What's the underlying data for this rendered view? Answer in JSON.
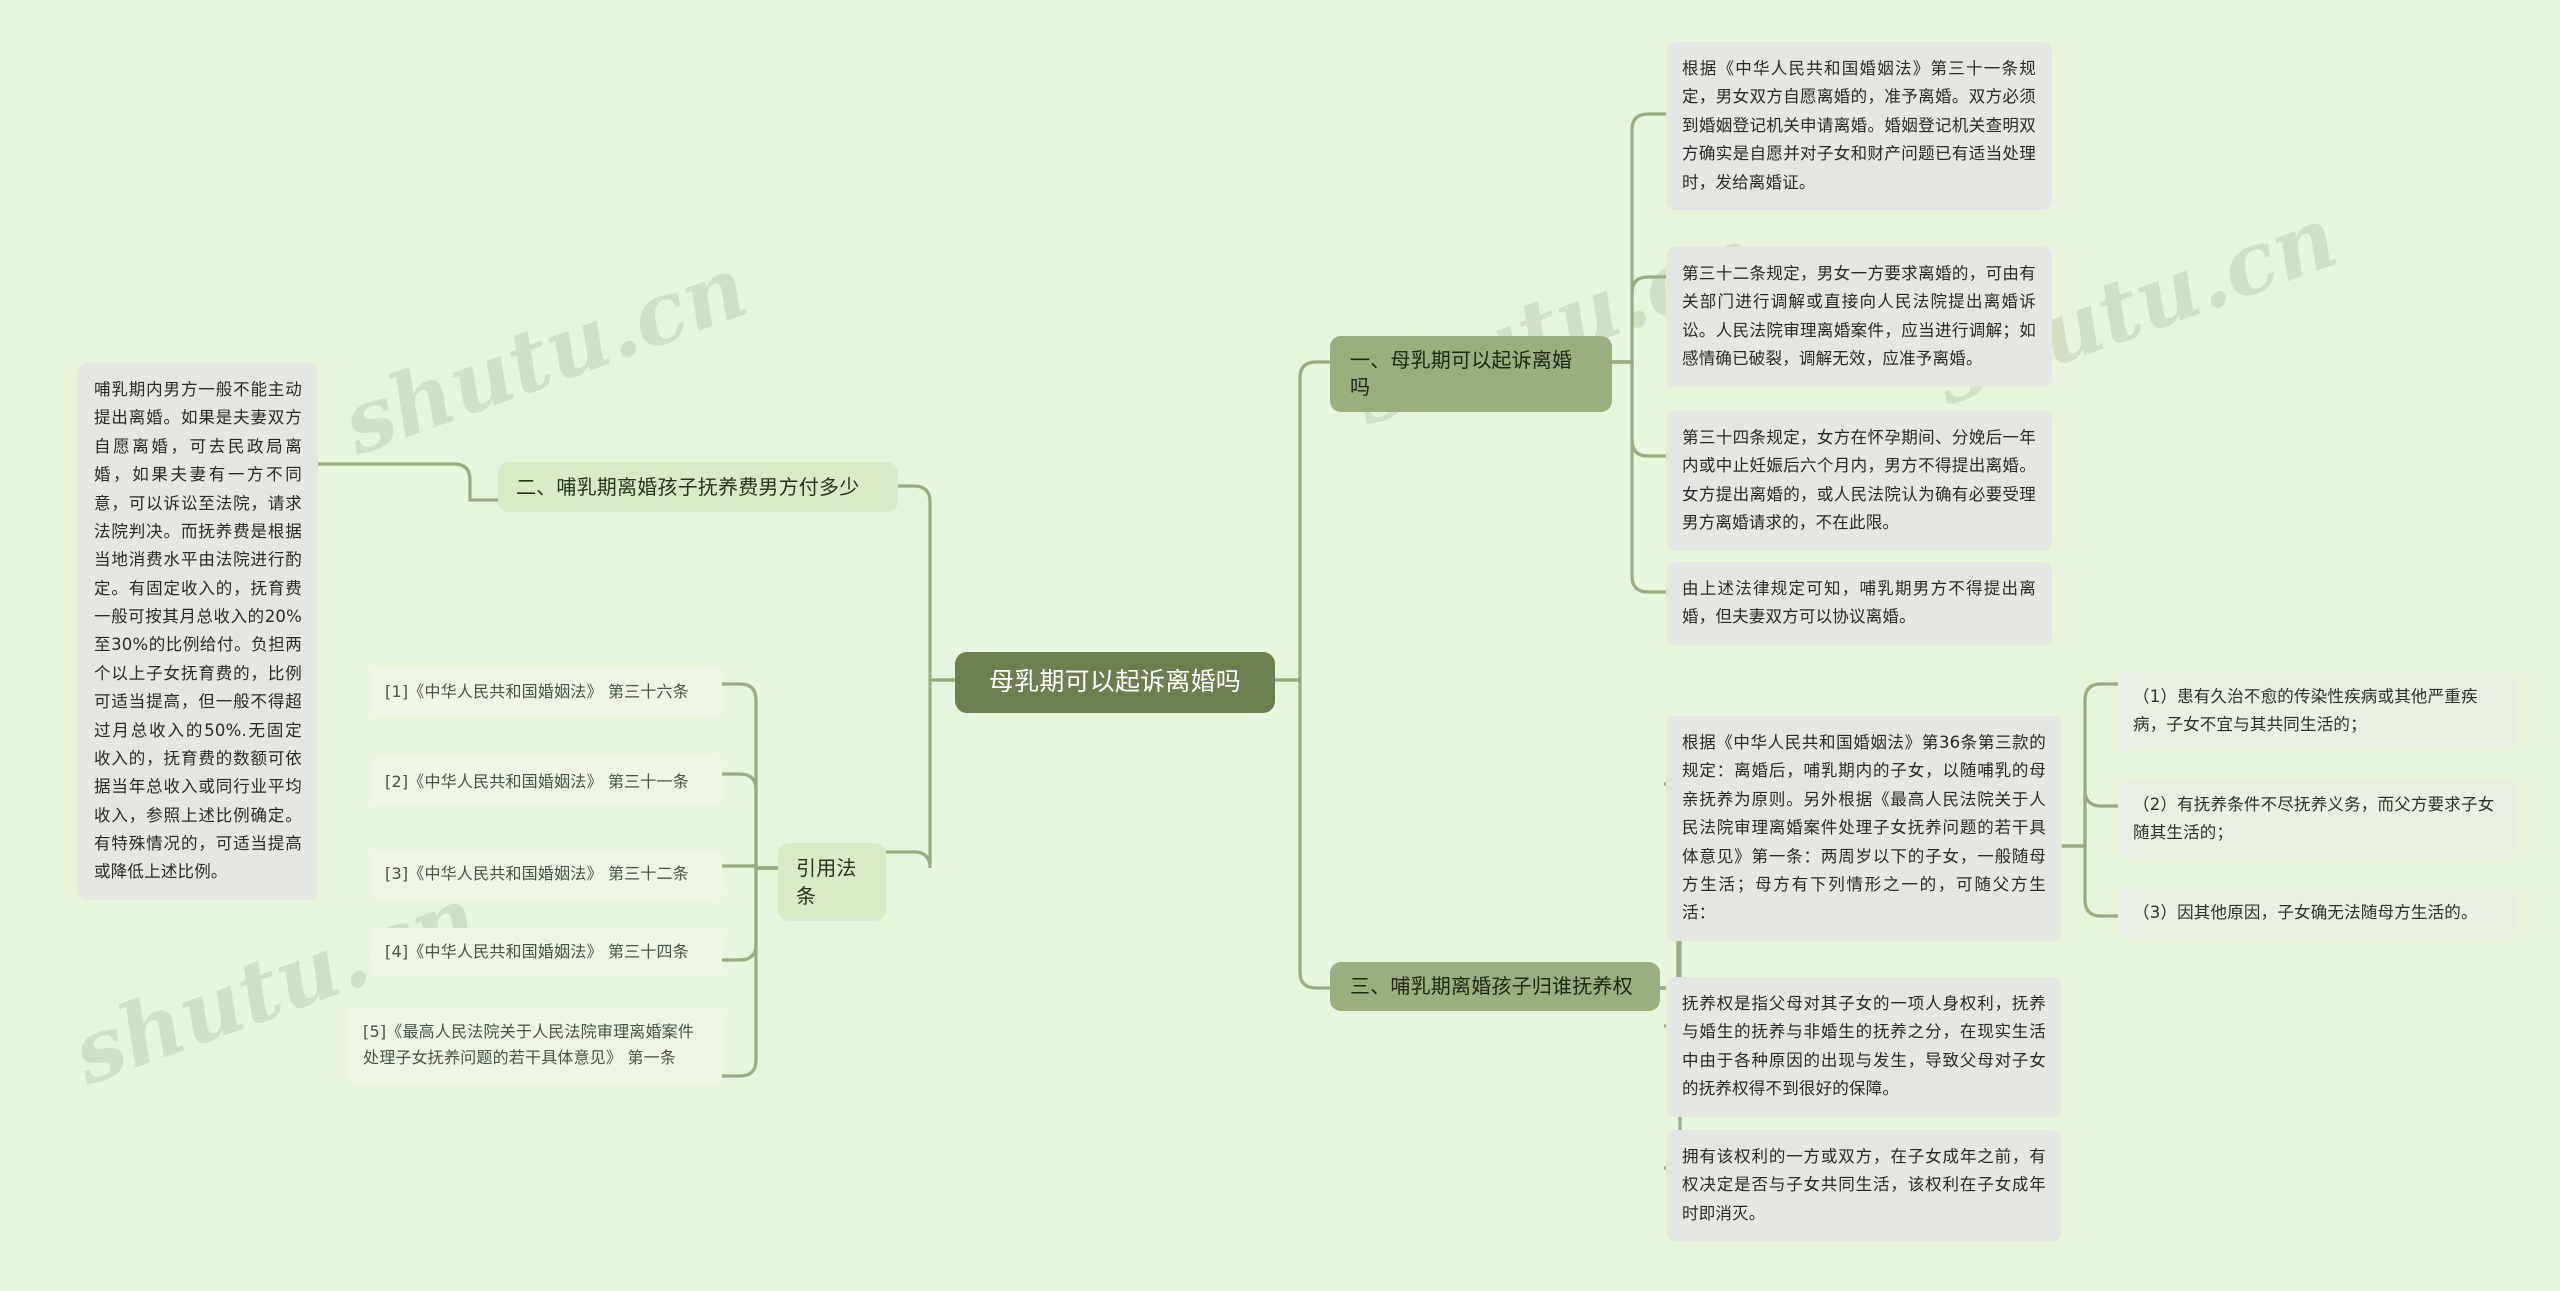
{
  "watermarks": {
    "a": "shutu.cn",
    "b": "shutu.cn",
    "c": "shutu.cn",
    "d": "shutu.cn"
  },
  "colors": {
    "canvas": "#e9f4dd",
    "root_fill": "#6d7f51",
    "root_text": "#ffffff",
    "branch_fill": "#9bae80",
    "chip_light_fill": "#d9ebc6",
    "card_fill": "#e4e7e1",
    "cite_fill": "#eef5e5",
    "subitem_fill": "#e9efe3",
    "wire": "#9aab82"
  },
  "root": {
    "label": "母乳期可以起诉离婚吗"
  },
  "branches": {
    "one": {
      "label": "一、母乳期可以起诉离婚吗",
      "cards": [
        "根据《中华人民共和国婚姻法》第三十一条规定，男女双方自愿离婚的，准予离婚。双方必须到婚姻登记机关申请离婚。婚姻登记机关查明双方确实是自愿并对子女和财产问题已有适当处理时，发给离婚证。",
        "第三十二条规定，男女一方要求离婚的，可由有关部门进行调解或直接向人民法院提出离婚诉讼。人民法院审理离婚案件，应当进行调解；如感情确已破裂，调解无效，应准予离婚。",
        "第三十四条规定，女方在怀孕期间、分娩后一年内或中止妊娠后六个月内，男方不得提出离婚。女方提出离婚的，或人民法院认为确有必要受理男方离婚请求的，不在此限。",
        "由上述法律规定可知，哺乳期男方不得提出离婚，但夫妻双方可以协议离婚。"
      ]
    },
    "two": {
      "label": "二、哺乳期离婚孩子抚养费男方付多少",
      "cards": [
        "哺乳期内男方一般不能主动提出离婚。如果是夫妻双方自愿离婚，可去民政局离婚，如果夫妻有一方不同意，可以诉讼至法院，请求法院判决。而抚养费是根据当地消费水平由法院进行酌定。有固定收入的，抚育费一般可按其月总收入的20%至30%的比例给付。负担两个以上子女抚育费的，比例可适当提高，但一般不得超过月总收入的50%.无固定收入的，抚育费的数额可依据当年总收入或同行业平均收入，参照上述比例确定。有特殊情况的，可适当提高或降低上述比例。"
      ]
    },
    "three": {
      "label": "三、哺乳期离婚孩子归谁抚养权",
      "cards": [
        "根据《中华人民共和国婚姻法》第36条第三款的规定：离婚后，哺乳期内的子女，以随哺乳的母亲抚养为原则。另外根据《最高人民法院关于人民法院审理离婚案件处理子女抚养问题的若干具体意见》第一条：两周岁以下的子女，一般随母方生活；母方有下列情形之一的，可随父方生活：",
        "抚养权是指父母对其子女的一项人身权利，抚养与婚生的抚养与非婚生的抚养之分，在现实生活中由于各种原因的出现与发生，导致父母对子女的抚养权得不到很好的保障。",
        "拥有该权利的一方或双方，在子女成年之前，有权决定是否与子女共同生活，该权利在子女成年时即消灭。"
      ],
      "subitems": [
        "（1）患有久治不愈的传染性疾病或其他严重疾病，子女不宜与其共同生活的；",
        "（2）有抚养条件不尽抚养义务，而父方要求子女随其生活的；",
        "（3）因其他原因，子女确无法随母方生活的。"
      ]
    },
    "citations": {
      "label": "引用法条",
      "items": [
        "[1]《中华人民共和国婚姻法》 第三十六条",
        "[2]《中华人民共和国婚姻法》 第三十一条",
        "[3]《中华人民共和国婚姻法》 第三十二条",
        "[4]《中华人民共和国婚姻法》 第三十四条",
        "[5]《最高人民法院关于人民法院审理离婚案件处理子女抚养问题的若干具体意见》 第一条"
      ]
    }
  }
}
